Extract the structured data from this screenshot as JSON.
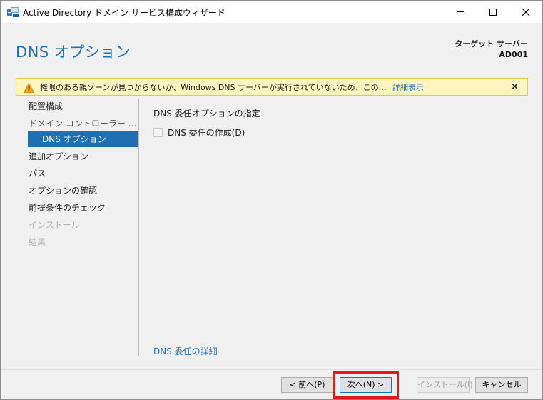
{
  "window": {
    "title": "Active Directory ドメイン サービス構成ウィザード"
  },
  "header": {
    "page_title": "DNS オプション",
    "target_label": "ターゲット サーバー",
    "target_value": "AD001"
  },
  "warning": {
    "text": "権限のある親ゾーンが見つからないか、Windows DNS サーバーが実行されていないため、この DNS サーバーの委任を作成でき...",
    "more_link": "詳細表示",
    "close": "×"
  },
  "nav": {
    "items": [
      {
        "label": "配置構成"
      },
      {
        "label": "ドメイン コントローラー オプション"
      },
      {
        "label": "DNS オプション"
      },
      {
        "label": "追加オプション"
      },
      {
        "label": "パス"
      },
      {
        "label": "オプションの確認"
      },
      {
        "label": "前提条件のチェック"
      },
      {
        "label": "インストール"
      },
      {
        "label": "結果"
      }
    ]
  },
  "content": {
    "heading": "DNS 委任オプションの指定",
    "checkbox_label": "DNS 委任の作成(D)",
    "details_link": "DNS 委任の詳細"
  },
  "footer": {
    "back": "< 前へ(P)",
    "next": "次へ(N) >",
    "install": "インストール(I)",
    "cancel": "キャンセル"
  },
  "colors": {
    "accent": "#1e6fb3",
    "warning_bg": "#fdf4bf",
    "highlight": "#e0191e"
  }
}
